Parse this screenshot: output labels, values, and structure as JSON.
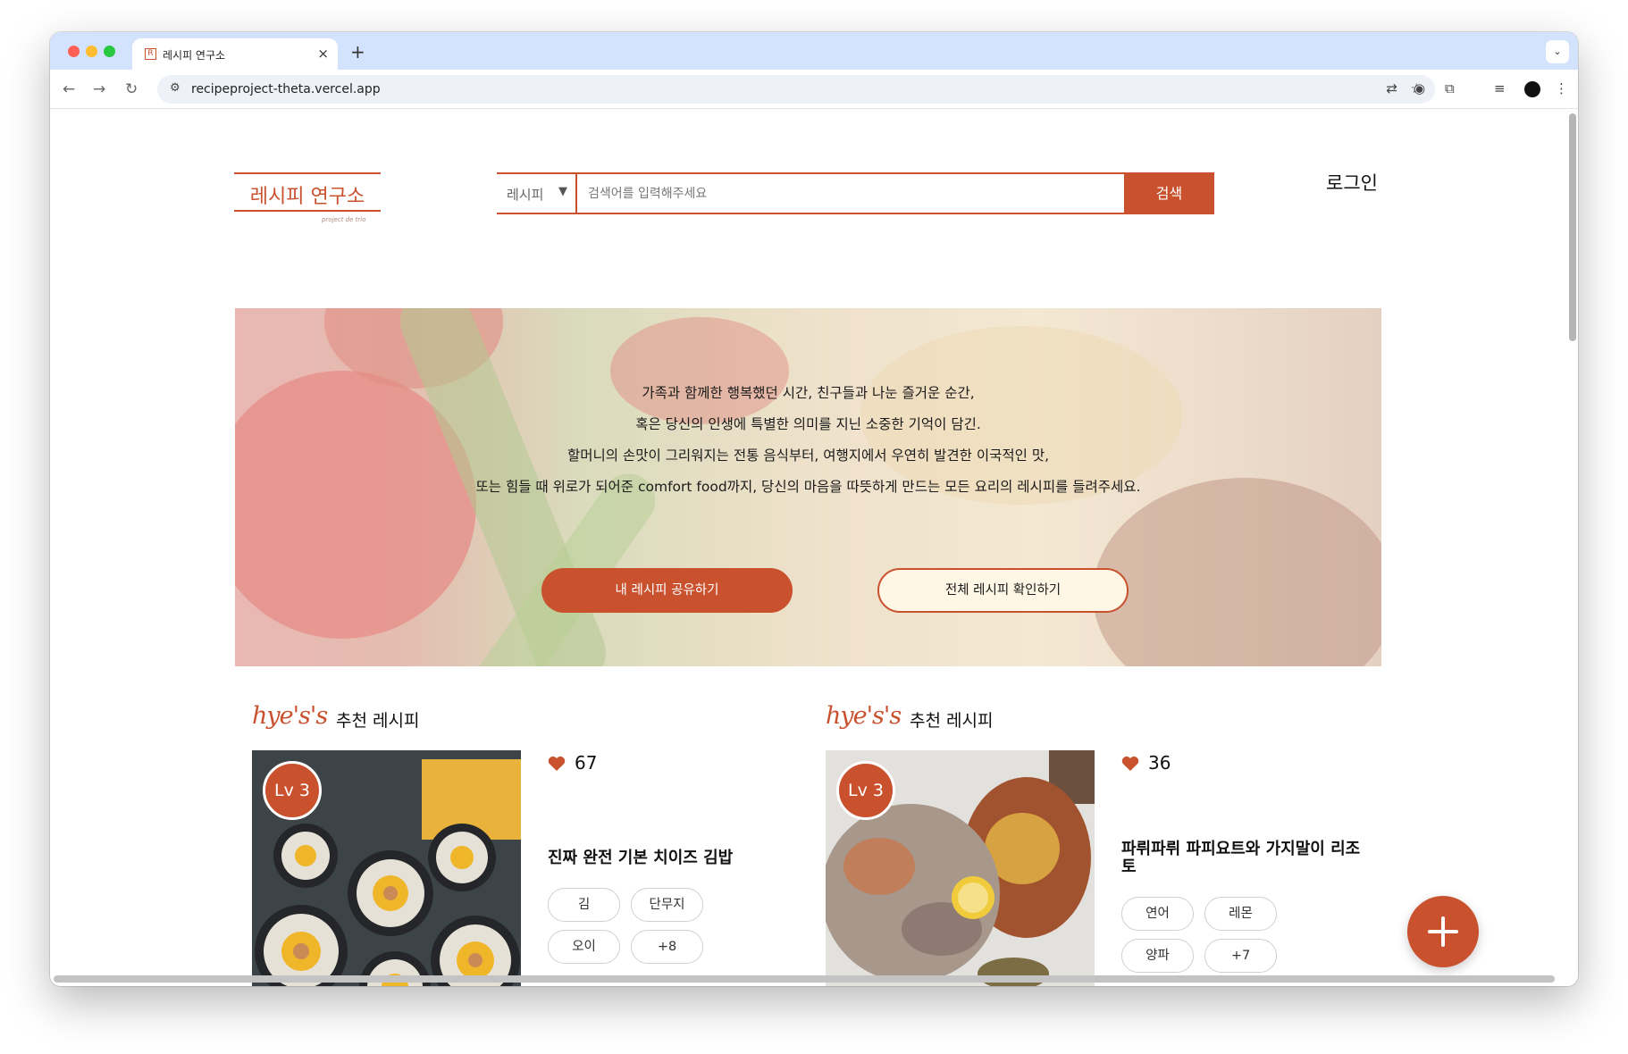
{
  "browser": {
    "tab_title": "레시피 연구소",
    "tab_favicon": "R",
    "new_tab": "+",
    "url": "recipeproject-theta.vercel.app"
  },
  "header": {
    "logo": "레시피 연구소",
    "logo_sub": "project de trio",
    "search_category": "레시피",
    "search_placeholder": "검색어를 입력해주세요",
    "search_button": "검색",
    "login": "로그인"
  },
  "hero": {
    "lines": [
      "가족과 함께한 행복했던 시간, 친구들과 나눈 즐거운 순간,",
      "혹은 당신의 인생에 특별한 의미를 지닌 소중한 기억이 담긴.",
      "할머니의 손맛이 그리워지는 전통 음식부터, 여행지에서 우연히 발견한 이국적인 맛,",
      "또는 힘들 때 위로가 되어준 comfort food까지, 당신의 마음을 따뜻하게 만드는 모든 요리의 레시피를 들려주세요."
    ],
    "primary_button": "내 레시피 공유하기",
    "secondary_button": "전체 레시피 확인하기"
  },
  "recommendations": [
    {
      "brand": "hye's's",
      "title": "추천 레시피",
      "level": "Lv 3",
      "likes": "67",
      "recipe_name": "진짜 완전 기본 치이즈 김밥",
      "ingredients": [
        "김",
        "단무지",
        "오이",
        "+8"
      ]
    },
    {
      "brand": "hye's's",
      "title": "추천 레시피",
      "level": "Lv 3",
      "likes": "36",
      "recipe_name": "파뤼파뤼 파피요트와 가지말이 리조토",
      "ingredients": [
        "연어",
        "레몬",
        "양파",
        "+7"
      ]
    }
  ],
  "icons": {
    "heart": "heart-icon",
    "fab": "plus-icon",
    "accent_color": "#c9512e"
  }
}
